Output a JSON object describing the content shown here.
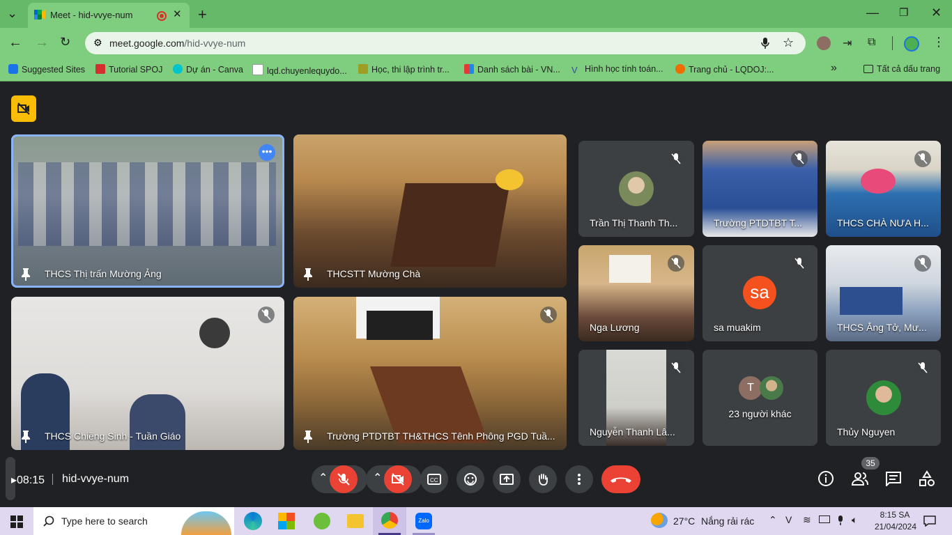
{
  "browser": {
    "tab_title": "Meet - hid-vvye-num",
    "url_host": "meet.google.com",
    "url_path": "/hid-vvye-num",
    "bookmarks": [
      "Suggested Sites",
      "Tutorial SPOJ",
      "Dự án - Canva",
      "lqd.chuyenlequydo...",
      "Học, thi lập trình tr...",
      "Danh sách bài - VN...",
      "Hình học tính toán...",
      "Trang chủ - LQDOJ:..."
    ],
    "all_bookmarks": "Tất cả dấu trang"
  },
  "meet": {
    "tiles_large": [
      "THCS Thị trấn Mường Ảng",
      "THCSTT Mường Chà",
      "THCS Chiềng Sinh - Tuần Giáo",
      "Trường PTDTBT TH&THCS Tênh Phông PGD Tuầ..."
    ],
    "tiles_small": [
      "Trần Thị Thanh Th...",
      "Trường PTDTBT T...",
      "THCS CHÀ NƯA H...",
      "Nga Lương",
      "sa muakim",
      "THCS Ẳng Tở, Mư...",
      "Nguyễn Thanh Lâ...",
      "23 người khác",
      "Thủy Nguyen"
    ],
    "sa_initials": "sa",
    "t_initial": "T",
    "time": "08:15",
    "meeting_code": "hid-vvye-num",
    "participant_count": "35"
  },
  "taskbar": {
    "search_placeholder": "Type here to search",
    "weather_temp": "27°C",
    "weather_desc": "Nắng rải rác",
    "clock_time": "8:15 SA",
    "clock_date": "21/04/2024"
  },
  "colors": {
    "meet_bg": "#202124",
    "end_call": "#ea4335",
    "chrome_green": "#7fcd7f"
  }
}
